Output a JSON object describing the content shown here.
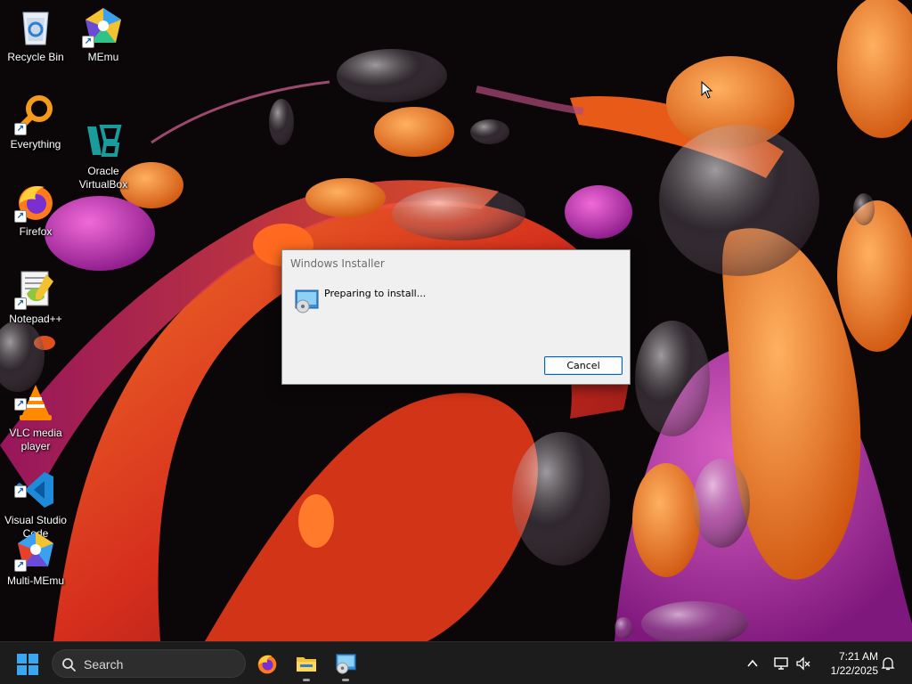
{
  "desktop": {
    "icons": [
      {
        "label": "Recycle Bin",
        "icon": "recycle-bin-icon"
      },
      {
        "label": "MEmu",
        "icon": "memu-icon"
      },
      {
        "label": "Everything",
        "icon": "everything-search-icon"
      },
      {
        "label": "Oracle\nVirtualBox",
        "icon": "virtualbox-icon"
      },
      {
        "label": "Firefox",
        "icon": "firefox-icon"
      },
      {
        "label": "Notepad++",
        "icon": "notepad-plus-plus-icon"
      },
      {
        "label": "VLC media\nplayer",
        "icon": "vlc-icon"
      },
      {
        "label": "Visual Studio\nCode",
        "icon": "vscode-icon"
      },
      {
        "label": "Multi-MEmu",
        "icon": "multi-memu-icon"
      }
    ]
  },
  "dialog": {
    "title": "Windows Installer",
    "message": "Preparing to install...",
    "cancel_label": "Cancel",
    "icon": "installer-icon"
  },
  "taskbar": {
    "search_placeholder": "Search",
    "apps": [
      "firefox-icon",
      "file-explorer-icon",
      "installer-icon"
    ],
    "tray": [
      "chevron-up-icon",
      "network-icon",
      "volume-muted-icon",
      "notification-bell-icon"
    ],
    "time": "7:21 AM",
    "date": "1/22/2025"
  },
  "colors": {
    "accent": "#0067c0",
    "taskbar_bg": "#1c1c1c",
    "dialog_bg": "#f0f0f0"
  }
}
